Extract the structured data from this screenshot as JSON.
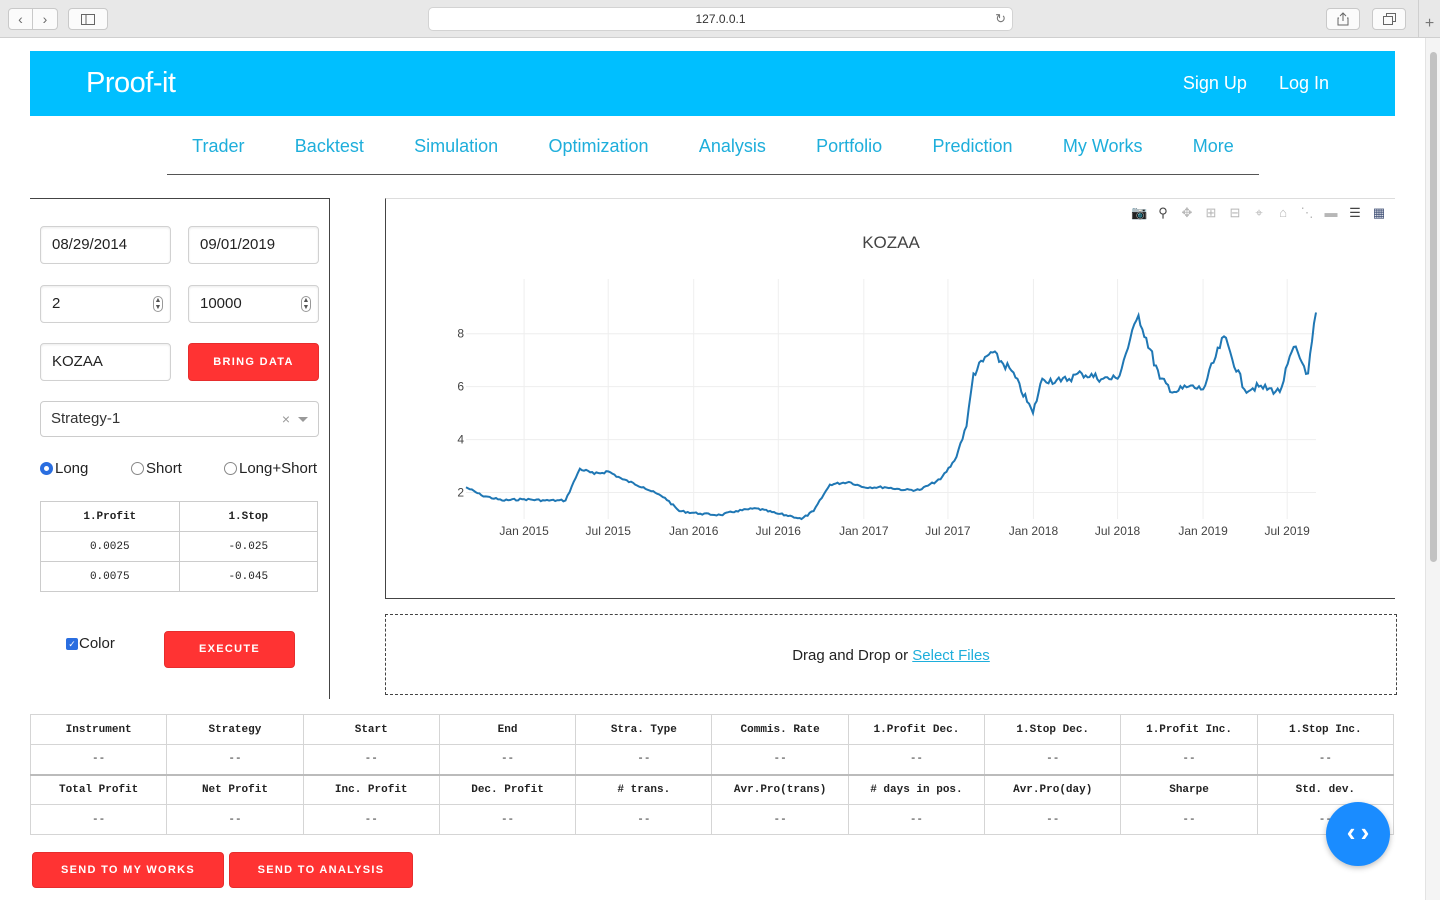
{
  "browser": {
    "url": "127.0.0.1",
    "back_icon": "chevron-left-icon",
    "forward_icon": "chevron-right-icon"
  },
  "header": {
    "brand": "Proof-it",
    "signup": "Sign Up",
    "login": "Log In",
    "color": "#00bfff"
  },
  "nav": {
    "items": [
      "Trader",
      "Backtest",
      "Simulation",
      "Optimization",
      "Analysis",
      "Portfolio",
      "Prediction",
      "My Works",
      "More"
    ]
  },
  "form": {
    "start_date": "08/29/2014",
    "end_date": "09/01/2019",
    "param_a": "2",
    "param_b": "10000",
    "symbol": "KOZAA",
    "bring_data": "BRING DATA",
    "strategy": "Strategy-1",
    "radio_long": "Long",
    "radio_short": "Short",
    "radio_long_short": "Long+Short",
    "params_table": {
      "headers": [
        "1.Profit",
        "1.Stop"
      ],
      "rows": [
        [
          "0.0025",
          "-0.025"
        ],
        [
          "0.0075",
          "-0.045"
        ]
      ]
    },
    "color_label": "Color",
    "execute": "EXECUTE"
  },
  "chart_data": {
    "type": "line",
    "title": "KOZAA",
    "xlabel": "",
    "ylabel": "",
    "x_ticks": [
      "Jan 2015",
      "Jul 2015",
      "Jan 2016",
      "Jul 2016",
      "Jan 2017",
      "Jul 2017",
      "Jan 2018",
      "Jul 2018",
      "Jan 2019",
      "Jul 2019"
    ],
    "y_ticks": [
      2,
      4,
      6,
      8
    ],
    "ylim": [
      1.0,
      9.5
    ],
    "xlim": [
      "2014-08-29",
      "2019-09-01"
    ],
    "line_color": "#1f77b4",
    "series": [
      {
        "x": [
          "2014-08-29",
          "2014-10-01",
          "2014-11-15",
          "2015-01-01",
          "2015-02-15",
          "2015-03-31",
          "2015-05-01",
          "2015-06-01",
          "2015-07-01",
          "2015-08-01",
          "2015-09-15",
          "2015-10-31",
          "2015-12-01",
          "2016-01-15",
          "2016-02-28",
          "2016-04-01",
          "2016-05-15",
          "2016-06-30",
          "2016-07-31",
          "2016-08-20",
          "2016-09-15",
          "2016-10-20",
          "2016-11-30",
          "2017-01-01",
          "2017-02-15",
          "2017-03-31",
          "2017-05-01",
          "2017-06-15",
          "2017-07-15",
          "2017-08-10",
          "2017-08-25",
          "2017-10-01",
          "2017-11-15",
          "2017-12-31",
          "2018-01-20",
          "2018-03-01",
          "2018-04-15",
          "2018-05-31",
          "2018-07-01",
          "2018-08-15",
          "2018-09-30",
          "2018-10-31",
          "2018-12-01",
          "2019-01-01",
          "2019-02-15",
          "2019-03-31",
          "2019-05-01",
          "2019-06-15",
          "2019-07-15",
          "2019-08-15",
          "2019-09-01"
        ],
        "y": [
          2.2,
          1.9,
          1.7,
          1.75,
          1.7,
          1.7,
          2.9,
          2.7,
          2.8,
          2.5,
          2.2,
          1.8,
          1.3,
          1.2,
          1.15,
          1.3,
          1.4,
          1.2,
          1.1,
          1.0,
          1.3,
          2.3,
          2.4,
          2.2,
          2.2,
          2.1,
          2.1,
          2.5,
          3.2,
          4.5,
          6.5,
          7.3,
          6.6,
          5.0,
          6.3,
          6.2,
          6.5,
          6.3,
          6.3,
          8.7,
          6.3,
          5.8,
          6.0,
          5.9,
          7.9,
          5.9,
          6.0,
          5.8,
          7.5,
          6.5,
          8.8
        ]
      }
    ]
  },
  "dropzone": {
    "text": "Drag and Drop or",
    "link": "Select Files"
  },
  "results": {
    "headers1": [
      "Instrument",
      "Strategy",
      "Start",
      "End",
      "Stra. Type",
      "Commis. Rate",
      "1.Profit Dec.",
      "1.Stop Dec.",
      "1.Profit Inc.",
      "1.Stop Inc."
    ],
    "values1": [
      "--",
      "--",
      "--",
      "--",
      "--",
      "--",
      "--",
      "--",
      "--",
      "--"
    ],
    "headers2": [
      "Total Profit",
      "Net Profit",
      "Inc. Profit",
      "Dec. Profit",
      "# trans.",
      "Avr.Pro(trans)",
      "# days in pos.",
      "Avr.Pro(day)",
      "Sharpe",
      "Std. dev."
    ],
    "values2": [
      "--",
      "--",
      "--",
      "--",
      "--",
      "--",
      "--",
      "--",
      "--",
      "--"
    ]
  },
  "actions": {
    "send_my_works": "SEND TO MY WORKS",
    "send_analysis": "SEND TO ANALYSIS"
  },
  "fab_icon": "code-icon"
}
